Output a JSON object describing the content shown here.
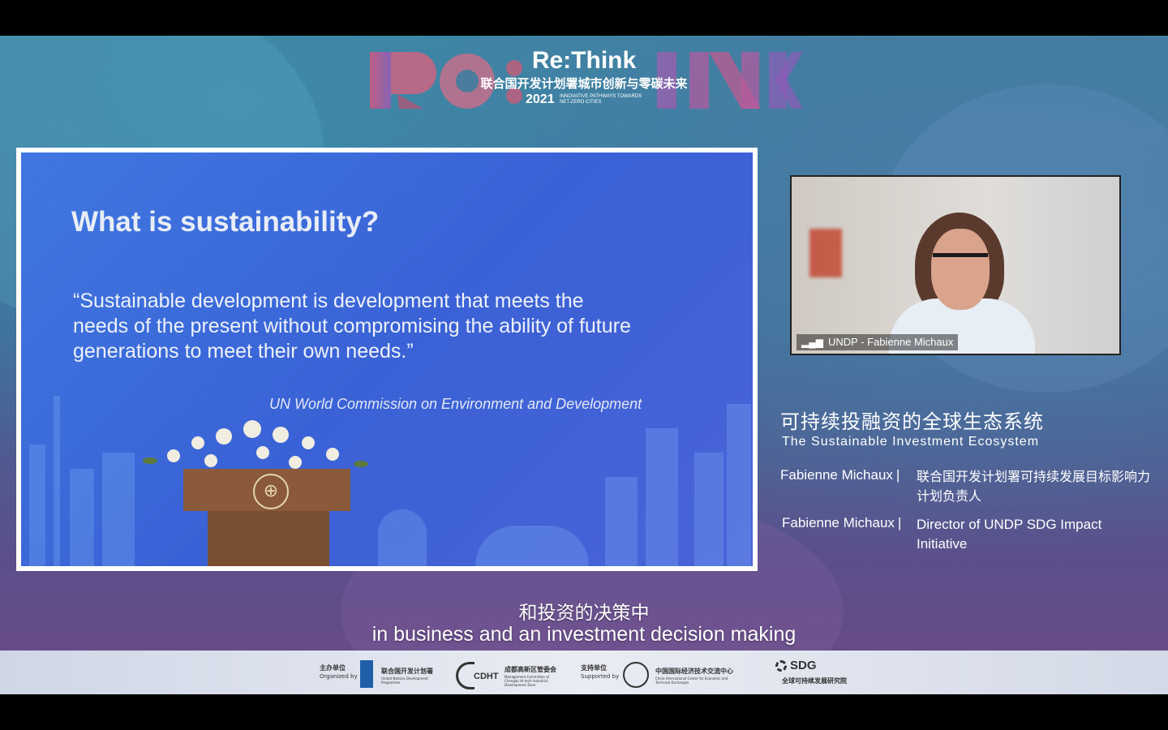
{
  "header": {
    "logo_title": "Re:Think",
    "logo_subtitle": "联合国开发计划署城市创新与零碳未来",
    "logo_year": "2021",
    "logo_tagline": "INNOVATIVE PATHWAYS TOWARDS NET-ZERO CITIES",
    "colors": {
      "accent_pink": "#d9557a",
      "accent_purple": "#9a5bb8"
    }
  },
  "slide": {
    "title": "What is sustainability?",
    "quote": "“Sustainable development is development that meets the needs of the present without compromising the ability of future generations to meet their own needs.”",
    "source": "UN World Commission on Environment and Development"
  },
  "video": {
    "label": "UNDP - Fabienne Michaux"
  },
  "talk": {
    "title_cn": "可持续投融资的全球生态系统",
    "title_en": "The Sustainable Investment Ecosystem"
  },
  "speaker": {
    "name_cn_line": "Fabienne Michaux",
    "separator": "|",
    "role_cn": "联合国开发计划署可持续发展目标影响力计划负责人",
    "name_en_line": "Fabienne Michaux",
    "role_en": "Director of UNDP SDG Impact Initiative"
  },
  "subtitles": {
    "cn": "和投资的决策中",
    "en": "in business and an investment decision making"
  },
  "footer": {
    "organized_cn": "主办单位",
    "organized_en": "Organized by",
    "undp_cn": "联合国开发计划署",
    "undp_en": "United Nations Development Programme",
    "cdht_cn": "成都高新区管委会",
    "cdht_en": "Management Committee of Chengdu Hi-tech Industrial Development Zone",
    "cdht_logo": "CDHT",
    "supported_cn": "支持单位",
    "supported_en": "Supported by",
    "cicete_cn": "中国国际经济技术交流中心",
    "cicete_en": "China International Center for Economic and Technical Exchanges",
    "sdg_logo": "SDG",
    "tsinghua_cn": "全球可持续发展研究院"
  }
}
